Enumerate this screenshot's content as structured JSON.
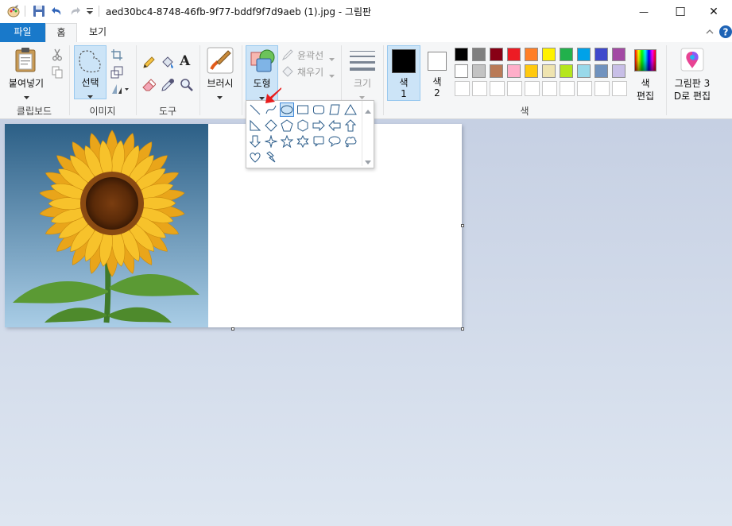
{
  "window": {
    "title": "aed30bc4-8748-46fb-9f77-bddf9f7d9aeb (1).jpg - 그림판",
    "minimize_glyph": "—",
    "maximize_glyph": "☐",
    "close_glyph": "✕"
  },
  "tabs": {
    "file": "파일",
    "home": "홈",
    "view": "보기"
  },
  "ribbon": {
    "clipboard": {
      "paste": "붙여넣기",
      "group": "클립보드"
    },
    "image": {
      "select": "선택",
      "group": "이미지"
    },
    "tools": {
      "group": "도구",
      "text_glyph": "A"
    },
    "brushes": {
      "label": "브러시"
    },
    "shapes": {
      "label": "도형",
      "outline": "윤곽선",
      "fill": "채우기"
    },
    "size": {
      "label": "크기"
    },
    "colors": {
      "color1_line1": "색",
      "color1_line2": "1",
      "color2_line1": "색",
      "color2_line2": "2",
      "edit_line1": "색",
      "edit_line2": "편집",
      "group": "색",
      "color1": "#000000",
      "color2": "#ffffff",
      "palette_row1": [
        "#000000",
        "#7f7f7f",
        "#880015",
        "#ed1c24",
        "#ff7f27",
        "#fff200",
        "#22b14c",
        "#00a2e8",
        "#3f48cc",
        "#a349a4"
      ],
      "palette_row2": [
        "#ffffff",
        "#c3c3c3",
        "#b97a57",
        "#ffaec9",
        "#ffc90e",
        "#efe4b0",
        "#b5e61d",
        "#99d9ea",
        "#7092be",
        "#c8bfe7"
      ]
    },
    "paint3d": {
      "line1": "그림판 3",
      "line2": "D로 편집"
    }
  },
  "shapes_gallery": [
    "line-shape",
    "curve-shape",
    "oval-shape",
    "rectangle-shape",
    "rounded-rectangle-shape",
    "polygon-shape",
    "triangle-shape",
    "right-triangle-shape",
    "diamond-shape",
    "pentagon-shape",
    "hexagon-shape",
    "right-arrow-shape",
    "left-arrow-shape",
    "up-arrow-shape",
    "down-arrow-shape",
    "four-point-star-shape",
    "five-point-star-shape",
    "six-point-star-shape",
    "rounded-callout-shape",
    "oval-callout-shape",
    "cloud-callout-shape",
    "heart-shape",
    "lightning-shape"
  ],
  "canvas": {
    "image": "sunflower"
  }
}
